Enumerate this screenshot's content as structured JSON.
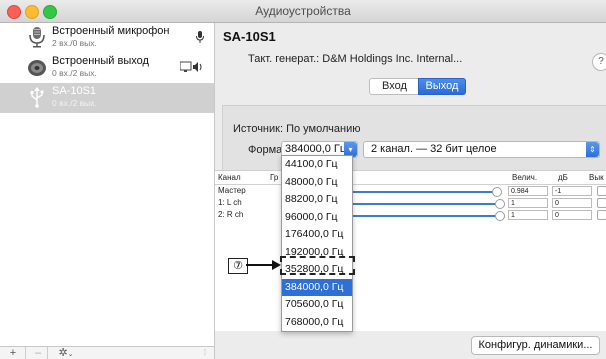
{
  "window": {
    "title": "Аудиоустройства"
  },
  "sidebar": {
    "devices": [
      {
        "name": "Встроенный микрофон",
        "sub": "2 вх./0 вых.",
        "icon": "microphone-icon",
        "right_icon": "mic-small-icon"
      },
      {
        "name": "Встроенный выход",
        "sub": "0 вх./2 вых.",
        "icon": "speaker-icon",
        "right_icon": "display-speaker-icon"
      },
      {
        "name": "SA-10S1",
        "sub": "0 вх./2 вых.",
        "icon": "usb-icon",
        "selected": true
      }
    ],
    "bottom": {
      "add": "+",
      "remove": "–",
      "gear": "✲"
    }
  },
  "main": {
    "device_title": "SA-10S1",
    "clock_label": "Такт. генерат.: D&M Holdings Inc. Internal...",
    "help": "?",
    "tabs": {
      "input": "Вход",
      "output": "Выход",
      "active": "output"
    },
    "source_label": "Источник: По умолчанию",
    "format_label": "Формат:",
    "format_value": "384000,0 Гц",
    "channel_format": "2 канал. — 32 бит целое",
    "table": {
      "headers": [
        "Канал",
        "Гр",
        "Велич.",
        "дБ",
        "Вык"
      ],
      "rows": [
        {
          "name": "Мастер",
          "value": "0.984",
          "db": "-1"
        },
        {
          "name": "1: L ch",
          "value": "1",
          "db": "0"
        },
        {
          "name": "2: R ch",
          "value": "1",
          "db": "0"
        }
      ]
    },
    "config_button": "Конфигур. динамики..."
  },
  "dropdown": {
    "items": [
      "44100,0 Гц",
      "48000,0 Гц",
      "88200,0 Гц",
      "96000,0 Гц",
      "176400,0 Гц",
      "192000,0 Гц",
      "352800,0 Гц",
      "384000,0 Гц",
      "705600,0 Гц",
      "768000,0 Гц"
    ],
    "selected_index": 7
  },
  "annotation": {
    "label": "⑦"
  }
}
